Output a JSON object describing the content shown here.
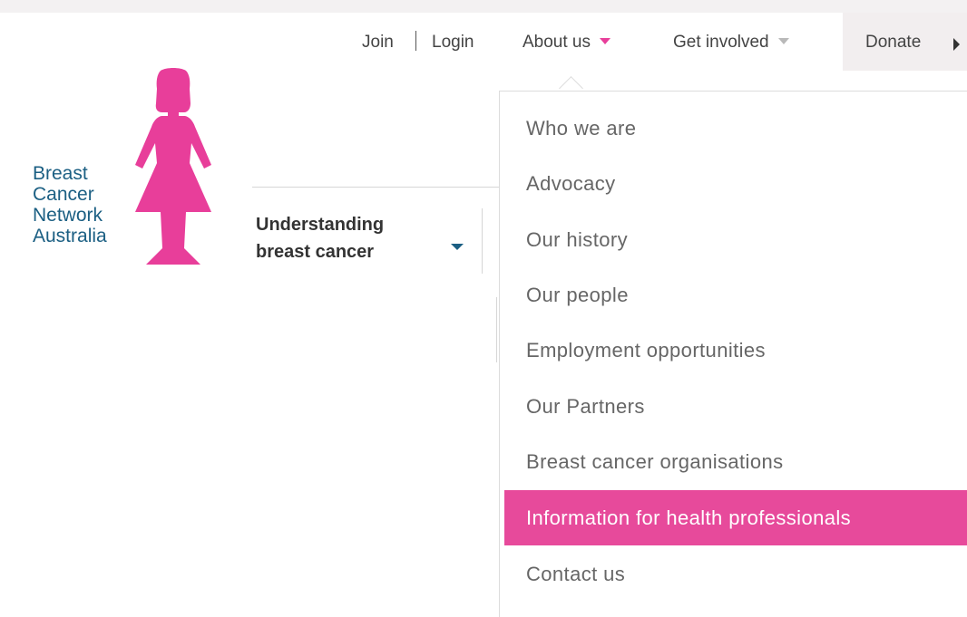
{
  "utility_nav": {
    "join": "Join",
    "login": "Login",
    "about_us": "About us",
    "get_involved": "Get involved",
    "donate": "Donate"
  },
  "logo": {
    "lines": [
      "Breast",
      "Cancer",
      "Network",
      "Australia"
    ]
  },
  "main_nav": {
    "understanding_line1": "Understanding",
    "understanding_line2": "breast cancer"
  },
  "about_menu": {
    "items": [
      {
        "label": "Who we are",
        "active": false
      },
      {
        "label": "Advocacy",
        "active": false
      },
      {
        "label": "Our history",
        "active": false
      },
      {
        "label": "Our people",
        "active": false
      },
      {
        "label": "Employment opportunities",
        "active": false
      },
      {
        "label": "Our Partners",
        "active": false
      },
      {
        "label": "Breast cancer organisations",
        "active": false
      },
      {
        "label": "Information for health professionals",
        "active": true
      },
      {
        "label": "Contact us",
        "active": false
      }
    ]
  },
  "colors": {
    "brand_pink": "#e83e9a",
    "brand_blue": "#1b5f83"
  },
  "icons": {
    "about_caret": "caret-down-icon",
    "get_involved_caret": "caret-down-icon",
    "donate_arrow": "arrow-right-icon",
    "nav_caret": "caret-down-icon"
  }
}
